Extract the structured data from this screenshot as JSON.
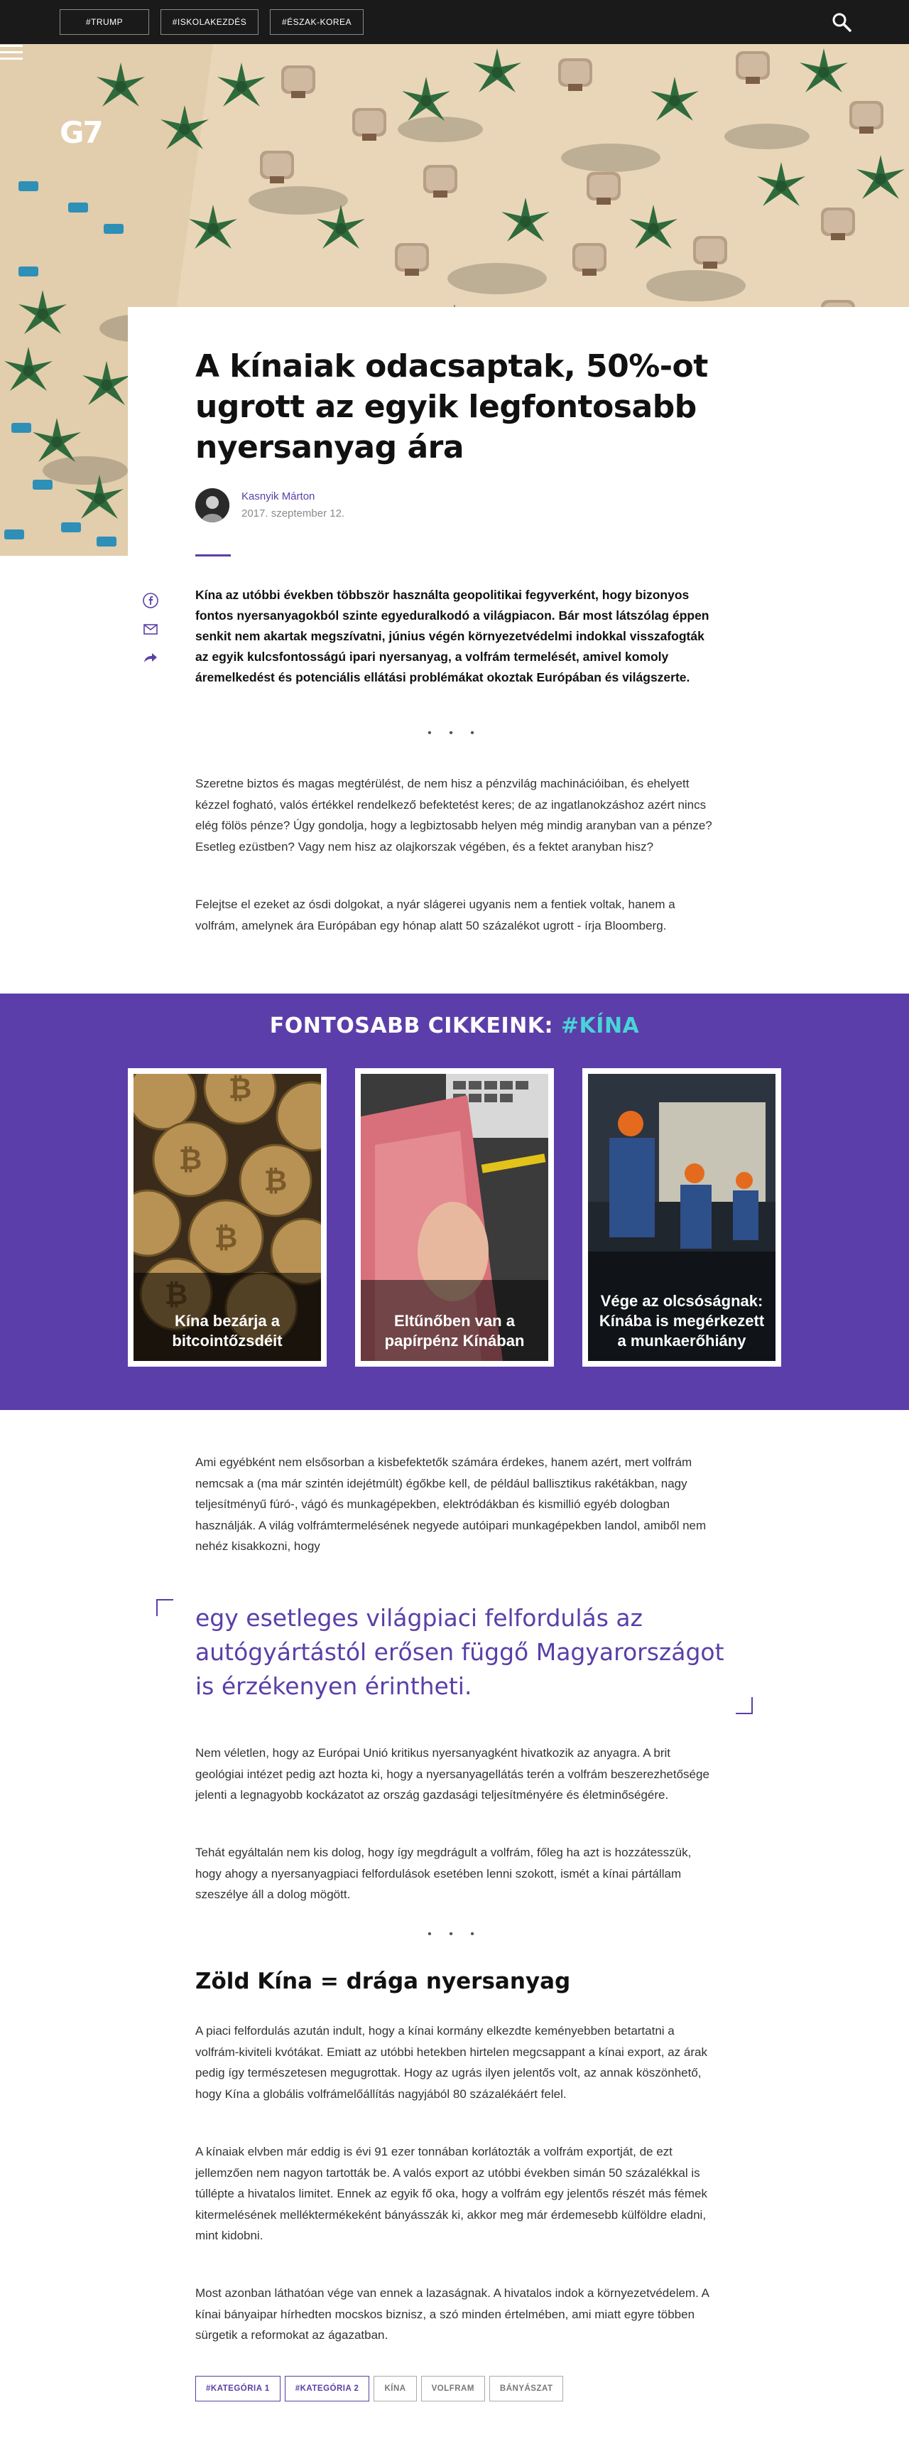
{
  "topbar": {
    "tags": [
      "#TRUMP",
      "#ISKOLAKEZDÉS",
      "#ÉSZAK-KOREA"
    ]
  },
  "hero": {
    "logo": "G7"
  },
  "article": {
    "title": "A kínaiak odacsaptak, 50%-ot ugrott az egyik legfontosabb nyersanyag ára",
    "author": "Kasnyik Márton",
    "date": "2017. szeptember 12.",
    "lead": "Kína az utóbbi években többször használta geopolitikai fegyverként, hogy bizonyos fontos nyersanyagokból szinte egyeduralkodó a világpiacon. Bár most látszólag éppen senkit nem akartak megszívatni, június végén környezetvédelmi indokkal visszafogták az egyik kulcsfontosságú ipari nyersanyag, a volfrám termelését, amivel komoly áremelkedést és potenciális ellátási problémákat okoztak Európában és világszerte.",
    "separator": "• • •",
    "p1": "Szeretne biztos és magas megtérülést, de nem hisz a pénzvilág machinációiban, és ehelyett kézzel fogható, valós értékkel rendelkező befektetést keres; de az ingatlanokzáshoz azért nincs elég fölös pénze? Úgy gondolja, hogy a legbiztosabb helyen még mindig aranyban van a pénze? Esetleg ezüstben? Vagy nem hisz az olajkorszak végében, és a fektet aranyban hisz?",
    "p2": "Felejtse el ezeket az ósdi dolgokat, a nyár slágerei ugyanis nem a fentiek voltak, hanem a volfrám, amelynek ára Európában egy hónap alatt 50 százalékot ugrott - írja Bloomberg.",
    "p3": "Ami egyébként nem elsősorban a kisbefektetők számára érdekes, hanem azért, mert volfrám nemcsak a (ma már szintén idejétmúlt) égőkbe kell, de például ballisztikus rakétákban, nagy teljesítményű fúró-, vágó és munkagépekben, elektródákban és kismillió egyéb dologban használják. A világ volfrámtermelésének negyede autóipari munkagépekben landol, amiből nem nehéz kisakkozni, hogy",
    "quote": "egy esetleges világpiaci felfordulás az autógyártástól erősen függő Magyarországot is érzékenyen érintheti.",
    "p4": "Nem véletlen, hogy az Európai Unió kritikus nyersanyagként hivatkozik az anyagra. A brit geológiai intézet pedig azt hozta ki, hogy a nyersanyagellátás terén a volfrám beszerezhetősége jelenti a legnagyobb kockázatot az ország gazdasági teljesítményére és életminőségére.",
    "p5": "Tehát egyáltalán nem kis dolog, hogy így megdrágult a volfrám, főleg ha azt is hozzátesszük, hogy ahogy a nyersanyagpiaci felfordulások esetében lenni szokott, ismét a kínai pártállam szeszélye áll a dolog mögött.",
    "subheading": "Zöld Kína = drága nyersanyag",
    "p6": "A piaci felfordulás azután indult, hogy a kínai kormány elkezdte keményebben betartatni a volfrám-kiviteli kvótákat. Emiatt az utóbbi hetekben hirtelen megcsappant a kínai export, az árak pedig így természetesen megugrottak. Hogy az ugrás ilyen jelentős volt, az annak köszönhető, hogy Kína a globális volfrámelőállítás nagyjából 80 százalékáért felel.",
    "p7": "A kínaiak elvben már eddig is évi 91 ezer tonnában korlátozták a volfrám exportját, de ezt jellemzően nem nagyon tartották be. A valós export az utóbbi években simán 50 százalékkal is túllépte a hivatalos limitet. Ennek az egyik fő oka, hogy a volfrám egy jelentős részét más fémek kitermelésének melléktermékeként bányásszák ki, akkor meg már érdemesebb külföldre eladni, mint kidobni.",
    "p8": "Most azonban láthatóan vége van ennek a lazaságnak. A hivatalos indok a környezetvédelem. A kínai bányaipar hírhedten mocskos biznisz, a szó minden értelmében, ami miatt egyre többen sürgetik a reformokat az ágazatban."
  },
  "promo": {
    "title_prefix": "FONTOSABB CIKKEINK: ",
    "title_hash": "#KÍNA",
    "cards": [
      {
        "caption": "Kína bezárja a bitcointőzsdéit"
      },
      {
        "caption": "Eltűnőben van a papírpénz Kínában"
      },
      {
        "caption": "Vége az olcsóságnak: Kínába is megérkezett a munkaerőhiány"
      }
    ]
  },
  "tags": [
    "#KATEGÓRIA 1",
    "#KATEGÓRIA 2",
    "KÍNA",
    "VOLFRAM",
    "BÁNYÁSZAT"
  ],
  "colors": {
    "accent": "#5b3eaa",
    "teal": "#49d3d6",
    "topbar": "#1a1a1a"
  }
}
